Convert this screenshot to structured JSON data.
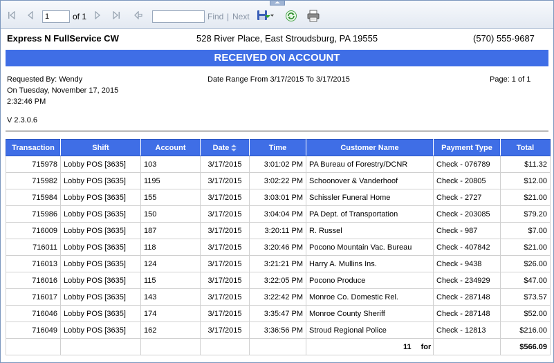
{
  "toolbar": {
    "page_value": "1",
    "of_label": "of 1",
    "search_value": "",
    "find_label": "Find",
    "separator": "|",
    "next_label": "Next"
  },
  "header": {
    "company": "Express N FullService CW",
    "address": "528 River Place, East Stroudsburg, PA 19555",
    "phone": "(570) 555-9687"
  },
  "report": {
    "title": "RECEIVED ON ACCOUNT",
    "requested_by": "Requested By: Wendy",
    "date_line": "On Tuesday, November 17, 2015",
    "time_line": "2:32:46 PM",
    "version": "V 2.3.0.6",
    "date_range": "Date Range From 3/17/2015 To 3/17/2015",
    "page_info": "Page: 1 of 1"
  },
  "table": {
    "columns": [
      "Transaction",
      "Shift",
      "Account",
      "Date",
      "Time",
      "Customer Name",
      "Payment Type",
      "Total"
    ],
    "rows": [
      [
        "715978",
        "Lobby POS [3635]",
        "103",
        "3/17/2015",
        "3:01:02 PM",
        "PA Bureau of Forestry/DCNR",
        "Check - 076789",
        "$11.32"
      ],
      [
        "715982",
        "Lobby POS [3635]",
        "1195",
        "3/17/2015",
        "3:02:22 PM",
        "Schoonover & Vanderhoof",
        "Check - 20805",
        "$12.00"
      ],
      [
        "715984",
        "Lobby POS [3635]",
        "155",
        "3/17/2015",
        "3:03:01 PM",
        "Schissler Funeral Home",
        "Check - 2727",
        "$21.00"
      ],
      [
        "715986",
        "Lobby POS [3635]",
        "150",
        "3/17/2015",
        "3:04:04 PM",
        "PA Dept. of Transportation",
        "Check - 203085",
        "$79.20"
      ],
      [
        "716009",
        "Lobby POS [3635]",
        "187",
        "3/17/2015",
        "3:20:11 PM",
        "R. Russel",
        "Check - 987",
        "$7.00"
      ],
      [
        "716011",
        "Lobby POS [3635]",
        "118",
        "3/17/2015",
        "3:20:46 PM",
        "Pocono Mountain Vac. Bureau",
        "Check - 407842",
        "$21.00"
      ],
      [
        "716013",
        "Lobby POS [3635]",
        "124",
        "3/17/2015",
        "3:21:21 PM",
        "Harry A. Mullins Ins.",
        "Check - 9438",
        "$26.00"
      ],
      [
        "716016",
        "Lobby POS [3635]",
        "115",
        "3/17/2015",
        "3:22:05 PM",
        "Pocono Produce",
        "Check - 234929",
        "$47.00"
      ],
      [
        "716017",
        "Lobby POS [3635]",
        "143",
        "3/17/2015",
        "3:22:42 PM",
        "Monroe Co. Domestic Rel.",
        "Check - 287148",
        "$73.57"
      ],
      [
        "716046",
        "Lobby POS [3635]",
        "174",
        "3/17/2015",
        "3:35:47 PM",
        "Monroe County Sheriff",
        "Check - 287148",
        "$52.00"
      ],
      [
        "716049",
        "Lobby POS [3635]",
        "162",
        "3/17/2015",
        "3:36:56 PM",
        "Stroud Regional Police",
        "Check - 12813",
        "$216.00"
      ]
    ],
    "footer": {
      "count": "11",
      "for_label": "for",
      "total": "$566.09"
    }
  },
  "icons": {
    "first": "first-page-icon",
    "prev": "prev-page-icon",
    "next": "next-page-icon",
    "last": "last-page-icon",
    "back": "back-icon",
    "export": "save-export-icon",
    "refresh": "refresh-icon",
    "print": "printer-icon"
  }
}
